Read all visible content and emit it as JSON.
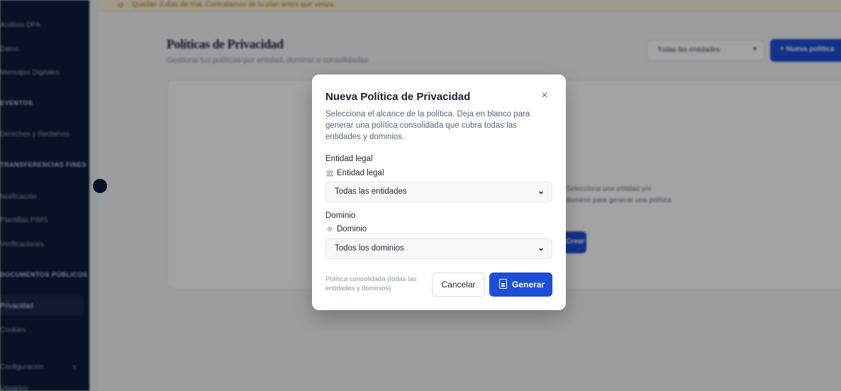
{
  "app": {
    "banner_text": "Quedan 3 días de trial. Contratamos de tu plan antes que venza.",
    "sidebar": {
      "items": [
        "Análisis DPA",
        "Datos",
        "Mensajes Digitales",
        "Derechos y Reclamos",
        "Notificación",
        "Plantillas PIMS",
        "Verificaciones",
        "Privacidad",
        "Cookies",
        "Configuración",
        "Usuarios"
      ],
      "sections": [
        "EVENTOS",
        "TRANSFERENCIAS FINES",
        "DOCUMENTOS PÚBLICOS"
      ],
      "active_item": "Privacidad"
    },
    "page": {
      "title": "Políticas de Privacidad",
      "subtitle": "Gestiona tus políticas por entidad, dominio o consolidadas",
      "filter_value": "Todas las entidades",
      "new_button": "+ Nueva política",
      "empty_text": [
        "Selecciona una entidad y/o",
        "dominio para generar una política"
      ],
      "empty_button": "Crear"
    }
  },
  "modal": {
    "title": "Nueva Política de Privacidad",
    "close_icon": "close-icon",
    "description": "Selecciona el alcance de la política. Deja en blanco para generar una política consolidada que cubra todas las entidades y dominios.",
    "entity": {
      "label": "Entidad legal",
      "sub_label": "Entidad legal",
      "icon": "building-icon",
      "selected": "Todas las entidades"
    },
    "domain": {
      "label": "Dominio",
      "sub_label": "Dominio",
      "icon": "globe-icon",
      "selected": "Todos los dominios"
    },
    "footer_note": "Política consolidada (todas las entidades y dominios)",
    "cancel_label": "Cancelar",
    "generate_label": "Generar",
    "generate_icon": "document-icon"
  },
  "colors": {
    "primary": "#1d4ed8",
    "sidebar": "#0d1b3a",
    "banner": "#fbf1d9"
  }
}
